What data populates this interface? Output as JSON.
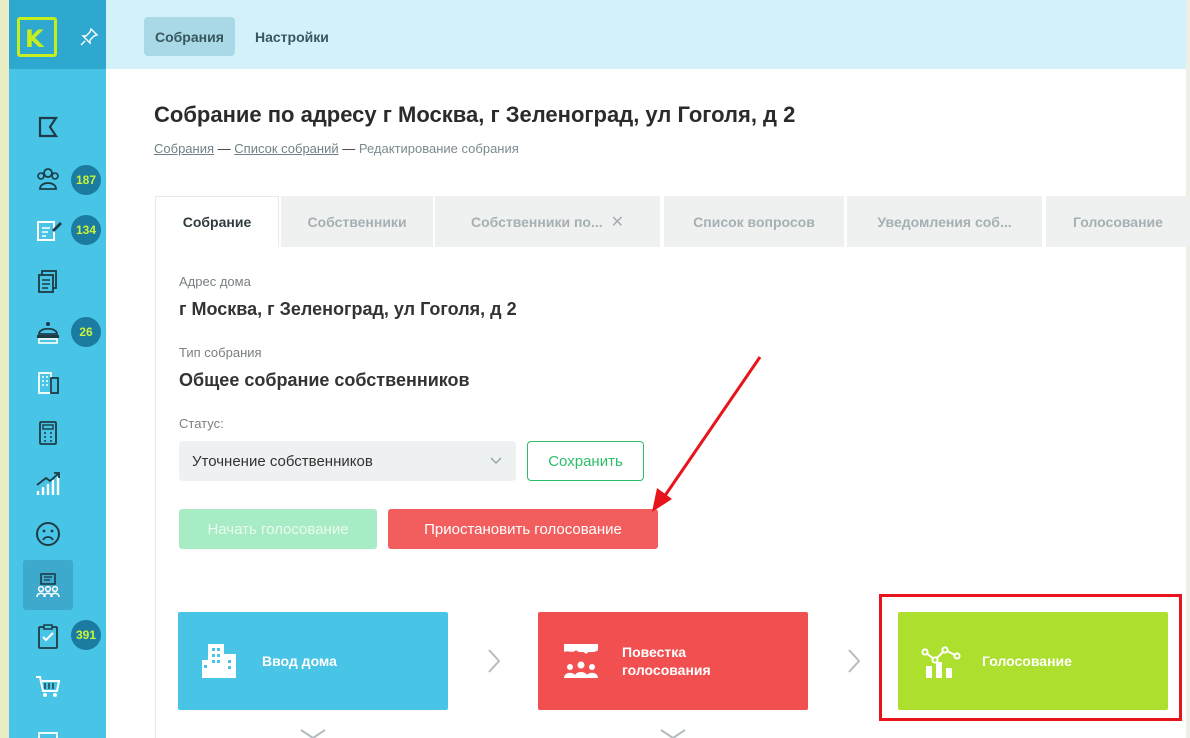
{
  "sidebar": {
    "logo_letter": "K",
    "badges": [
      "187",
      "134",
      "26",
      "391"
    ]
  },
  "topbar": {
    "tabs": [
      {
        "label": "Собрания"
      },
      {
        "label": "Настройки"
      }
    ]
  },
  "page": {
    "title": "Собрание по адресу г Москва, г Зеленоград, ул Гоголя, д 2",
    "breadcrumb": {
      "item1": "Собрания",
      "item2": "Список собраний",
      "current": "Редактирование собрания",
      "sep": "—"
    }
  },
  "tabs": [
    {
      "label": "Собрание"
    },
    {
      "label": "Собственники"
    },
    {
      "label": "Собственники по...",
      "close": "✕"
    },
    {
      "label": "Список вопросов"
    },
    {
      "label": "Уведомления соб..."
    },
    {
      "label": "Голосование"
    }
  ],
  "form": {
    "address_label": "Адрес дома",
    "address_value": "г Москва, г Зеленоград, ул Гоголя, д 2",
    "type_label": "Тип собрания",
    "type_value": "Общее собрание собственников",
    "status_label": "Статус:",
    "status_value": "Уточнение собственников",
    "save_label": "Сохранить",
    "start_label": "Начать голосование",
    "pause_label": "Приостановить голосование"
  },
  "stages": [
    {
      "label": "Ввод дома",
      "color": "#48c5e6"
    },
    {
      "label": "Повестка голосования",
      "color": "#f25050"
    },
    {
      "label": "Голосование",
      "color": "#addf2f"
    }
  ],
  "colors": {
    "sidebar": "#48c5e6",
    "accent_green": "#2dbd69",
    "danger": "#f25e5e",
    "annotation": "#e8141c"
  }
}
